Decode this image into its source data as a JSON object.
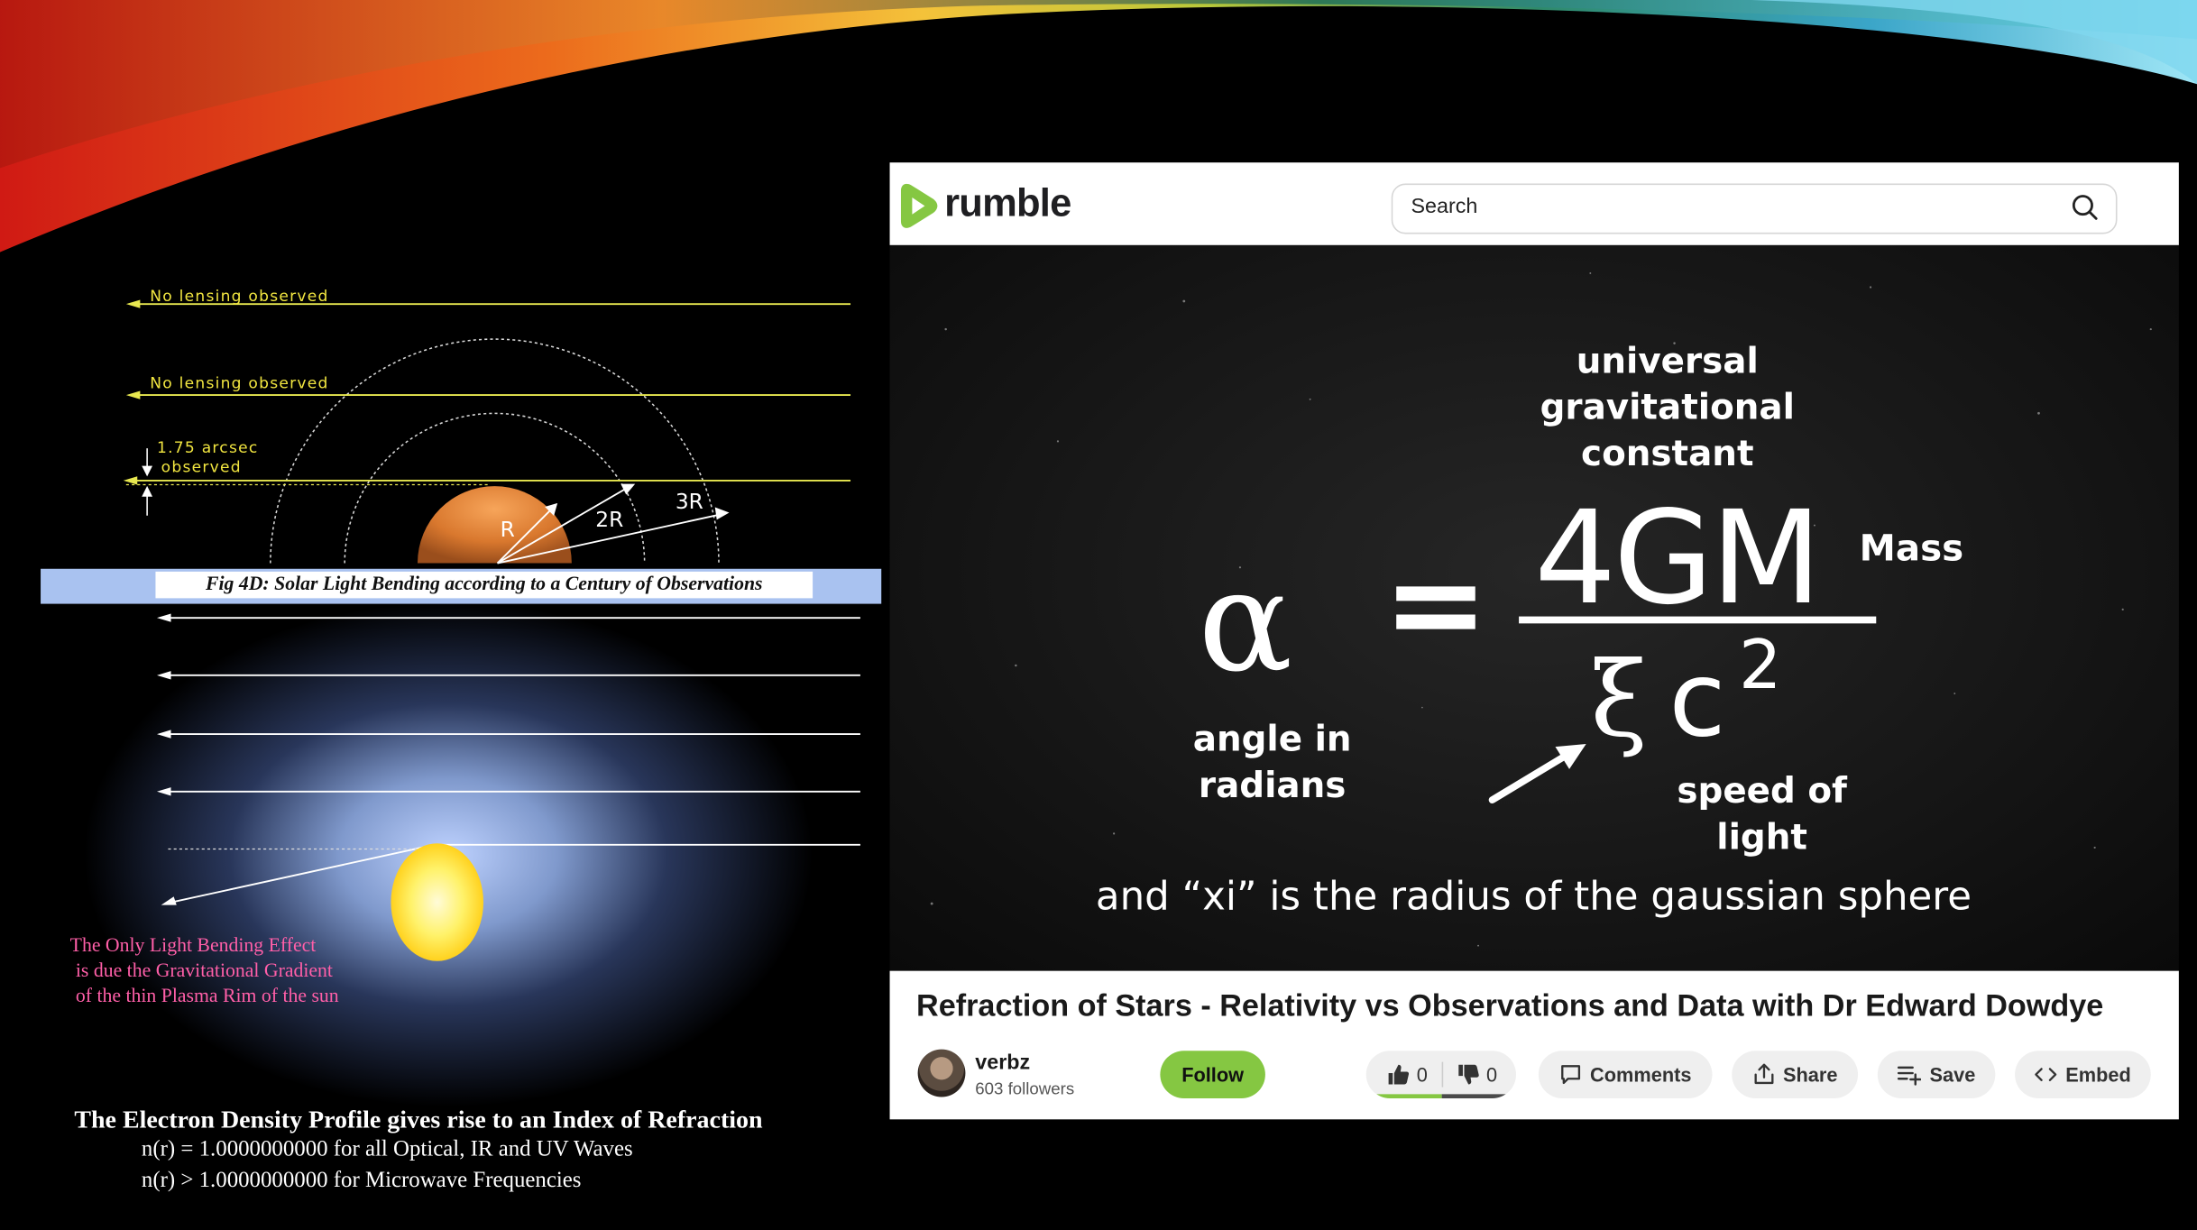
{
  "slide": {
    "line_labels": [
      "No lensing observed",
      "No lensing observed"
    ],
    "arcsec_label": [
      "1.75 arcsec",
      "observed"
    ],
    "radius_labels": [
      "R",
      "2R",
      "3R"
    ],
    "fig_caption": "Fig 4D: Solar Light Bending according to a Century of Observations",
    "plasma_note": [
      "The Only Light Bending Effect",
      "is due the Gravitational Gradient",
      "of the thin Plasma Rim of the sun"
    ],
    "density_title": "The Electron Density Profile gives rise to an Index of Refraction",
    "density_lines": [
      "n(r) = 1.0000000000 for all Optical, IR and UV Waves",
      "n(r) > 1.0000000000 for Microwave Frequencies"
    ]
  },
  "rumble": {
    "logo_text": "rumble",
    "search_placeholder": "Search",
    "video_frame": {
      "constant_label": [
        "universal",
        "gravitational",
        "constant"
      ],
      "alpha": "α",
      "equals": "=",
      "numerator": "4GM",
      "mass_label": "Mass",
      "xi": "ξ",
      "c": "c",
      "exponent": "2",
      "angle_label": [
        "angle in",
        "radians"
      ],
      "speed_label": [
        "speed of",
        "light"
      ],
      "caption": "and “xi” is the radius of the gaussian sphere"
    },
    "title": "Refraction of Stars - Relativity vs Observations and Data with Dr Edward Dowdye",
    "channel": {
      "name": "verbz",
      "followers": "603 followers"
    },
    "follow_label": "Follow",
    "likes": "0",
    "dislikes": "0",
    "actions": {
      "comments": "Comments",
      "share": "Share",
      "save": "Save",
      "embed": "Embed"
    },
    "colors": {
      "brand_green": "#85c742",
      "like_bar": "#85c742",
      "dislike_bar": "#4a4a4a"
    }
  }
}
